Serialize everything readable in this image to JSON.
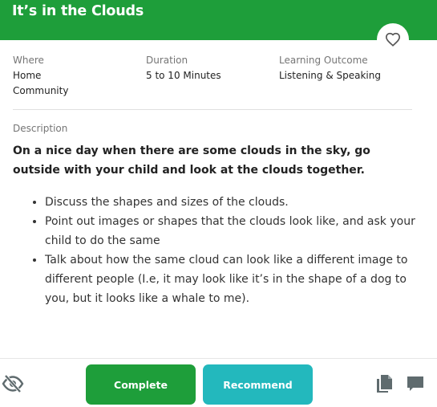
{
  "header": {
    "title": "It’s in the Clouds",
    "favorite_icon": "heart-outline-icon",
    "background": "#1e9e3a"
  },
  "meta": {
    "where": {
      "label": "Where",
      "values": [
        "Home",
        "Community"
      ]
    },
    "duration": {
      "label": "Duration",
      "value": "5 to 10 Minutes"
    },
    "outcome": {
      "label": "Learning Outcome",
      "value": "Listening & Speaking"
    }
  },
  "description": {
    "label": "Description",
    "text": "On a nice day when there are some clouds in the sky, go outside with your child and look at the clouds together.",
    "bullets": [
      "Discuss the shapes and sizes of the clouds.",
      "Point out images or shapes that the clouds look like, and ask your child to do the same",
      "Talk about how the same cloud can look like a different image to different people (I.e, it may look like it’s in the shape of a dog to you, but it looks like a whale to me)."
    ]
  },
  "footer": {
    "hide_icon": "eye-slash-icon",
    "complete_label": "Complete",
    "recommend_label": "Recommend",
    "copy_icon": "copy-icon",
    "comment_icon": "comment-icon",
    "colors": {
      "complete": "#1e9e3a",
      "recommend": "#23b8bd",
      "icon": "#5f6b6e"
    }
  }
}
